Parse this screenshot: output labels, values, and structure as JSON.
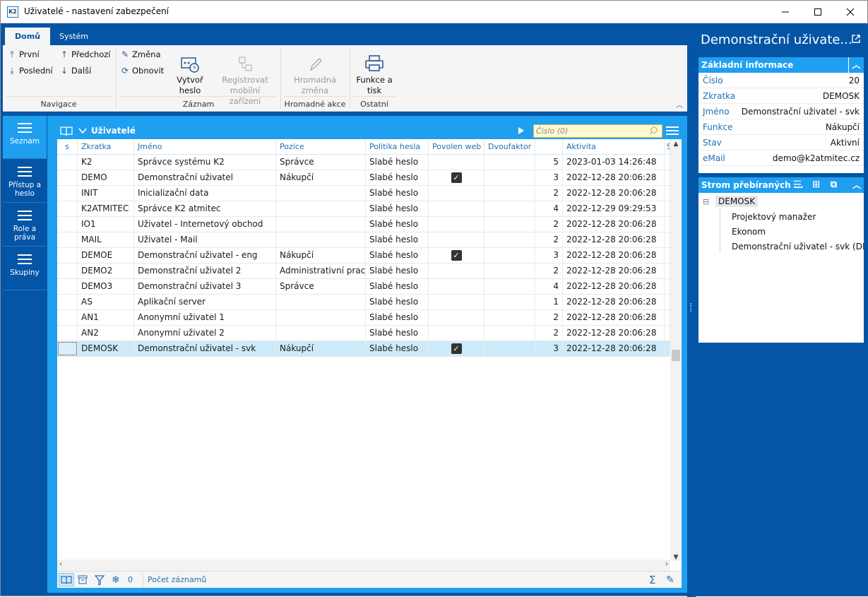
{
  "window": {
    "title": "Uživatelé - nastavení zabezpečení"
  },
  "ribbon": {
    "tabs": [
      {
        "label": "Domů"
      },
      {
        "label": "Systém"
      }
    ],
    "nav": {
      "first": "První",
      "prev": "Předchozí",
      "last": "Poslední",
      "next": "Další",
      "group": "Navigace"
    },
    "record": {
      "change": "Změna",
      "refresh": "Obnovit",
      "create_pw_1": "Vytvoř",
      "create_pw_2": "heslo",
      "reg_1": "Registrovat",
      "reg_2": "mobilní zařízení",
      "group": "Záznam"
    },
    "bulk": {
      "label_1": "Hromadná",
      "label_2": "změna",
      "group": "Hromadné akce"
    },
    "other": {
      "label_1": "Funkce a",
      "label_2": "tisk",
      "group": "Ostatní"
    }
  },
  "leftnav": [
    {
      "label_1": "Seznam",
      "label_2": ""
    },
    {
      "label_1": "Přístup a",
      "label_2": "heslo"
    },
    {
      "label_1": "Role a",
      "label_2": "práva"
    },
    {
      "label_1": "Skupiny",
      "label_2": ""
    }
  ],
  "grid": {
    "title": "Uživatelé",
    "search_placeholder": "Číslo (0)",
    "columns": [
      "s",
      "Zkratka",
      "Jméno",
      "Pozice",
      "Politika hesla",
      "Povolen web",
      "Dvoufaktor",
      "",
      "Aktivita",
      "S"
    ],
    "rows": [
      {
        "code": "K2",
        "name": "Správce systému K2",
        "pos": "Správce",
        "policy": "Slabé heslo",
        "web": false,
        "n": "5",
        "act": "2023-01-03 14:26:48"
      },
      {
        "code": "DEMO",
        "name": "Demonstrační uživatel",
        "pos": "Nákupčí",
        "policy": "Slabé heslo",
        "web": true,
        "n": "3",
        "act": "2022-12-28 20:06:28"
      },
      {
        "code": "INIT",
        "name": "Inicializační data",
        "pos": "",
        "policy": "Slabé heslo",
        "web": false,
        "n": "2",
        "act": "2022-12-28 20:06:28"
      },
      {
        "code": "K2ATMITEC",
        "name": "Správce K2 atmitec",
        "pos": "",
        "policy": "Slabé heslo",
        "web": false,
        "n": "4",
        "act": "2022-12-29 09:29:53"
      },
      {
        "code": "IO1",
        "name": "Uživatel - Internetový obchod",
        "pos": "",
        "policy": "Slabé heslo",
        "web": false,
        "n": "2",
        "act": "2022-12-28 20:06:28"
      },
      {
        "code": "MAIL",
        "name": "Uživatel - Mail",
        "pos": "",
        "policy": "Slabé heslo",
        "web": false,
        "n": "2",
        "act": "2022-12-28 20:06:28"
      },
      {
        "code": "DEMOE",
        "name": "Demonstrační uživatel - eng",
        "pos": "Nákupčí",
        "policy": "Slabé heslo",
        "web": true,
        "n": "3",
        "act": "2022-12-28 20:06:28"
      },
      {
        "code": "DEMO2",
        "name": "Demonstrační uživatel 2",
        "pos": "Administrativní prac",
        "policy": "Slabé heslo",
        "web": false,
        "n": "2",
        "act": "2022-12-28 20:06:28"
      },
      {
        "code": "DEMO3",
        "name": "Demonstrační uživatel 3",
        "pos": "Správce",
        "policy": "Slabé heslo",
        "web": false,
        "n": "4",
        "act": "2022-12-28 20:06:28"
      },
      {
        "code": "AS",
        "name": "Aplikační server",
        "pos": "",
        "policy": "Slabé heslo",
        "web": false,
        "n": "1",
        "act": "2022-12-28 20:06:28"
      },
      {
        "code": "AN1",
        "name": "Anonymní uživatel 1",
        "pos": "",
        "policy": "Slabé heslo",
        "web": false,
        "n": "2",
        "act": "2022-12-28 20:06:28"
      },
      {
        "code": "AN2",
        "name": "Anonymní uživatel 2",
        "pos": "",
        "policy": "Slabé heslo",
        "web": false,
        "n": "2",
        "act": "2022-12-28 20:06:28"
      },
      {
        "code": "DEMOSK",
        "name": "Demonstrační uživatel - svk",
        "pos": "Nákupčí",
        "policy": "Slabé heslo",
        "web": true,
        "n": "3",
        "act": "2022-12-28 20:06:28",
        "selected": true
      }
    ],
    "footer": {
      "count": "0",
      "label": "Počet záznamů"
    }
  },
  "panel": {
    "title": "Demonstrační uživate...",
    "basic": {
      "header": "Základní informace",
      "fields": [
        {
          "k": "Číslo",
          "v": "20"
        },
        {
          "k": "Zkratka",
          "v": "DEMOSK"
        },
        {
          "k": "Jméno",
          "v": "Demonstrační uživatel - svk"
        },
        {
          "k": "Funkce",
          "v": "Nákupčí"
        },
        {
          "k": "Stav",
          "v": "Aktivní"
        },
        {
          "k": "eMail",
          "v": "demo@k2atmitec.cz"
        }
      ]
    },
    "tree": {
      "header": "Strom přebíraných ...",
      "root": "DEMOSK",
      "children": [
        "Projektový manažer",
        "Ekonom",
        "Demonstrační uživatel - svk (DEM"
      ]
    }
  },
  "colors": {
    "brand": "#0455a6",
    "accent": "#1f9ff0",
    "selected_row": "#cdeaf9"
  }
}
